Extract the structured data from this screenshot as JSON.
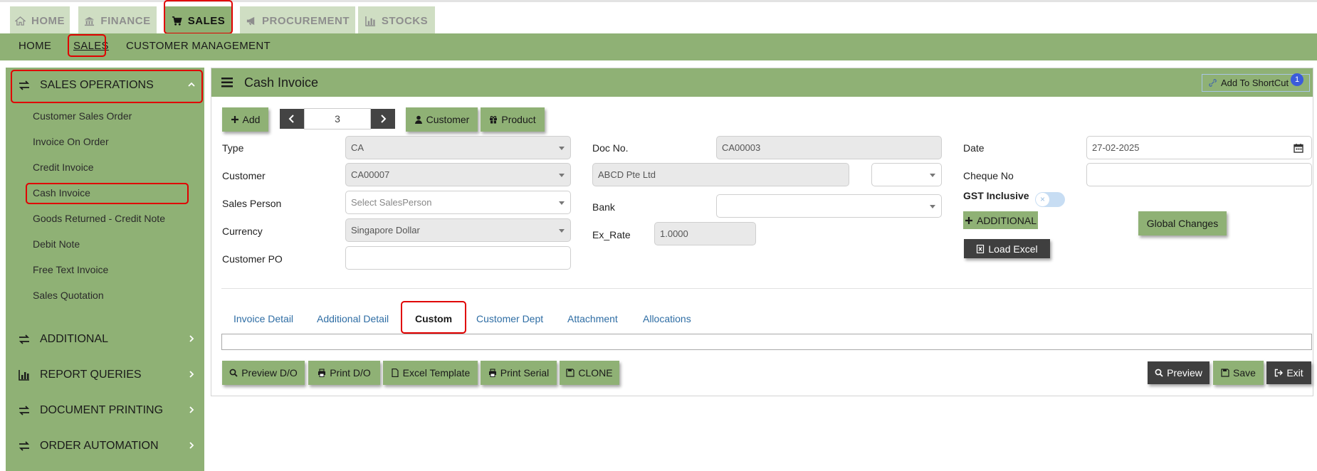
{
  "top_tabs": [
    {
      "label": "HOME",
      "icon": "home-icon"
    },
    {
      "label": "FINANCE",
      "icon": "bank-icon"
    },
    {
      "label": "SALES",
      "icon": "cart-icon"
    },
    {
      "label": "PROCUREMENT",
      "icon": "megaphone-icon"
    },
    {
      "label": "STOCKS",
      "icon": "bar-chart-icon"
    }
  ],
  "subnav": [
    "HOME",
    "SALES",
    "CUSTOMER MANAGEMENT"
  ],
  "sidebar": {
    "section": "SALES OPERATIONS",
    "items": [
      "Customer Sales Order",
      "Invoice On Order",
      "Credit Invoice",
      "Cash Invoice",
      "Goods Returned - Credit Note",
      "Debit Note",
      "Free Text Invoice",
      "Sales Quotation"
    ],
    "groups": [
      "ADDITIONAL",
      "REPORT QUERIES",
      "DOCUMENT PRINTING",
      "ORDER AUTOMATION"
    ]
  },
  "page": {
    "title": "Cash Invoice",
    "shortcut_label": "Add To ShortCut",
    "shortcut_badge": "1"
  },
  "toolbar": {
    "add": "Add",
    "page_number": "3",
    "customer": "Customer",
    "product": "Product"
  },
  "form": {
    "type_label": "Type",
    "type_value": "CA",
    "customer_label": "Customer",
    "customer_value": "CA00007",
    "salesperson_label": "Sales Person",
    "salesperson_placeholder": "Select SalesPerson",
    "currency_label": "Currency",
    "currency_value": "Singapore Dollar",
    "customer_po_label": "Customer PO",
    "customer_po_value": "",
    "docno_label": "Doc No.",
    "docno_value": "CA00003",
    "customer_name_value": "ABCD Pte Ltd",
    "bank_label": "Bank",
    "exrate_label": "Ex_Rate",
    "exrate_value": "1.0000",
    "date_label": "Date",
    "date_value": "27-02-2025",
    "cheque_label": "Cheque No",
    "gst_label": "GST Inclusive",
    "additional_button": "ADDITIONAL",
    "load_excel_button": "Load Excel",
    "global_changes_button": "Global Changes"
  },
  "tabs": [
    "Invoice Detail",
    "Additional Detail",
    "Custom",
    "Customer Dept",
    "Attachment",
    "Allocations"
  ],
  "actions": {
    "preview_do": "Preview D/O",
    "print_do": "Print D/O",
    "excel_template": "Excel Template",
    "print_serial": "Print Serial",
    "clone": "CLONE",
    "preview": "Preview",
    "save": "Save",
    "exit": "Exit"
  },
  "colors": {
    "accent_green": "#8fb175",
    "highlight_red": "#e00000",
    "dark_button": "#3f3f3f",
    "link_blue": "#2e6da4"
  }
}
